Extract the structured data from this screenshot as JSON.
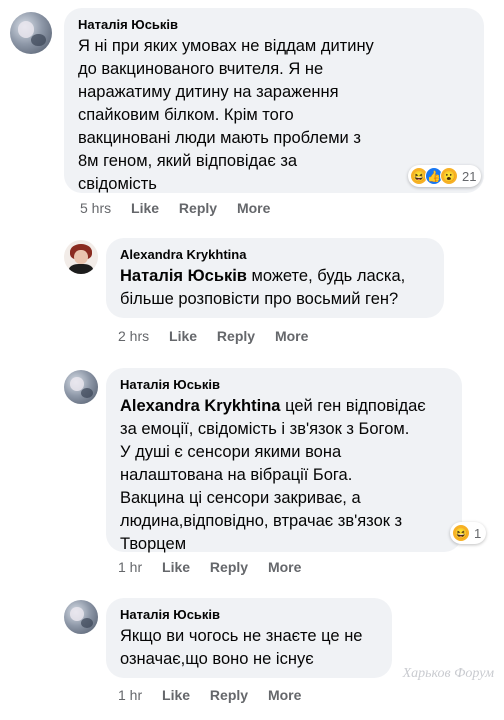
{
  "comments": [
    {
      "author": "Наталія Юськів",
      "text": "Я ні при яких умовах не віддам дитину\nдо вакцинованого вчителя. Я не\nнаражатиму дитину на зараження\nспайковим білком. Крім того\nвакциновані люди мають проблеми з\n8м геном, який відповідає за\nсвідомість",
      "time": "5 hrs",
      "reactions": {
        "icons": [
          "haha-icon",
          "like-icon",
          "wow-icon"
        ],
        "count": "21"
      }
    },
    {
      "author": "Alexandra Krykhtina",
      "mention": "Наталія Юськів",
      "text": " можете, будь ласка,\nбільше розповісти про восьмий ген?",
      "time": "2 hrs"
    },
    {
      "author": "Наталія Юськів",
      "mention": "Alexandra Krykhtina",
      "text": " цей ген відповідає\nза емоції, свідомість і зв'язок з Богом.\nУ душі є сенсори якими вона\nналаштована на вібрації Бога.\nВакцина ці сенсори закриває, а\nлюдина,відповідно, втрачає зв'язок з\nТворцем",
      "time": "1 hr",
      "reactions": {
        "icons": [
          "haha-icon"
        ],
        "count": "1"
      }
    },
    {
      "author": "Наталія Юськів",
      "text": "Якщо ви чогось не знаєте це не\nозначає,що воно не існує",
      "time": "1 hr"
    }
  ],
  "actions": {
    "like": "Like",
    "reply": "Reply",
    "more": "More"
  },
  "watermark": "Харьков Форум"
}
